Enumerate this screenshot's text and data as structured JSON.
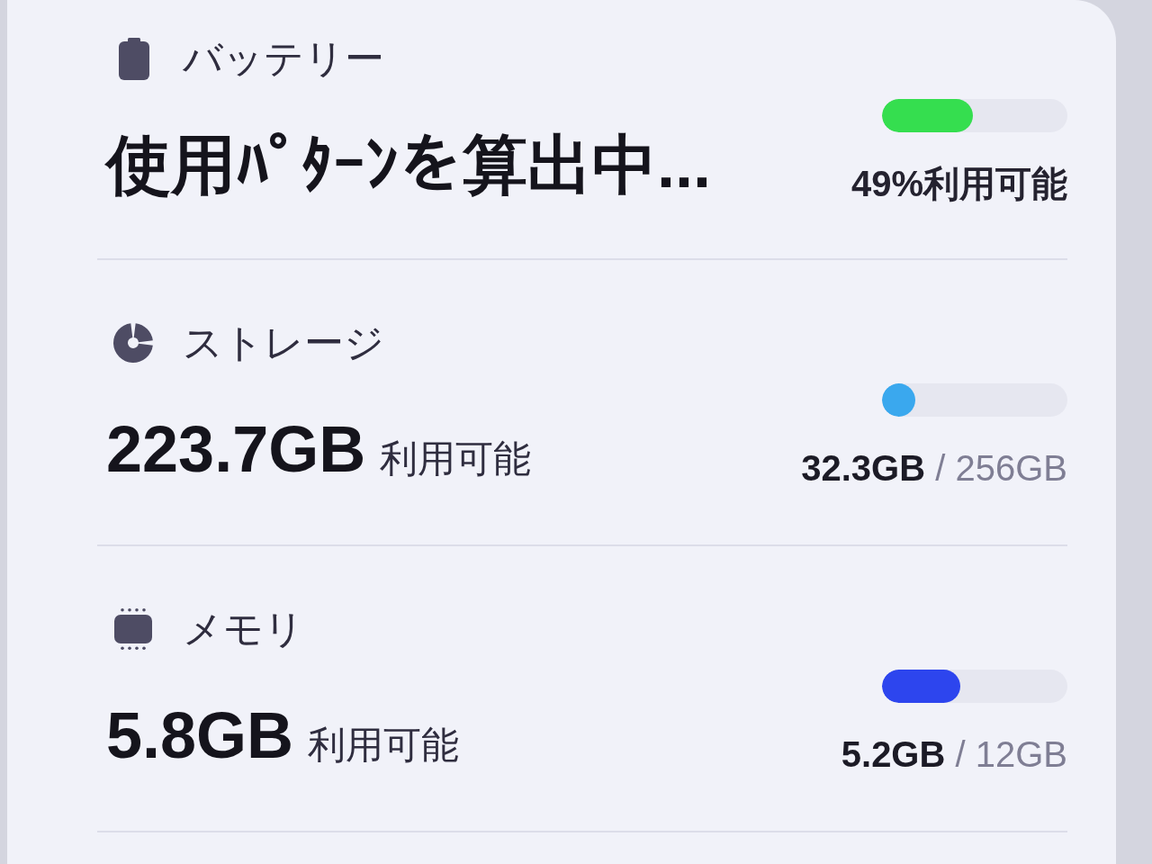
{
  "sections": [
    {
      "kind": "battery",
      "title": "バッテリー",
      "value": "使用ﾊﾟﾀｰﾝを算出中...",
      "level": 0.49,
      "color": "#35de4f",
      "reading": "49%利用可能"
    },
    {
      "kind": "storage",
      "title": "ストレージ",
      "value": "223.7GB",
      "value_note": "利用可能",
      "level": 0.13,
      "color": "#3aa8ee",
      "reading": "**32.3GB** / 256GB"
    },
    {
      "kind": "memory",
      "title": "メモリ",
      "value": "5.8GB",
      "value_note": "利用可能",
      "level": 0.42,
      "color": "#2d45ee",
      "reading": "**5.2GB** / 12GB"
    }
  ]
}
